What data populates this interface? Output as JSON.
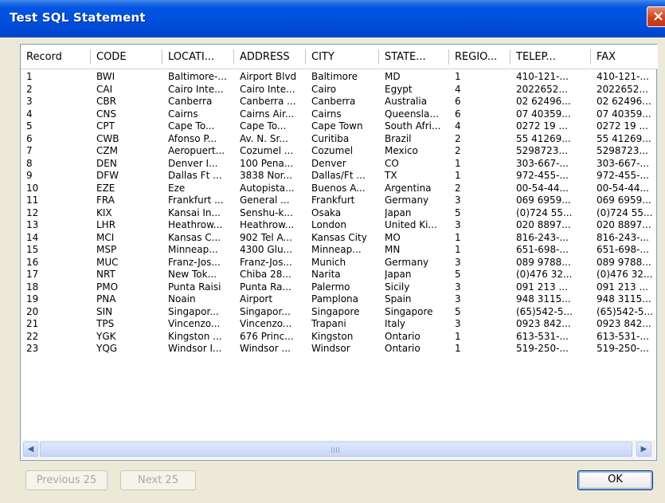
{
  "window": {
    "title": "Test SQL Statement",
    "close_symbol": "×"
  },
  "table": {
    "columns": [
      "Record",
      "CODE",
      "LOCATI...",
      "ADDRESS",
      "CITY",
      "STATE...",
      "REGIO...",
      "TELEP...",
      "FAX"
    ],
    "rows": [
      [
        "1",
        "BWI",
        "Baltimore-...",
        "Airport Blvd",
        "Baltimore",
        "MD",
        "1",
        "410-121-...",
        "410-121-..."
      ],
      [
        "2",
        "CAI",
        "Cairo Inte...",
        "Cairo Inte...",
        "Cairo",
        "Egypt",
        "4",
        "2022652...",
        "2022652..."
      ],
      [
        "3",
        "CBR",
        "Canberra",
        "Canberra ...",
        "Canberra",
        "Australia",
        "6",
        "02 62496...",
        "02 62496..."
      ],
      [
        "4",
        "CNS",
        "Cairns",
        "Cairns Air...",
        "Cairns",
        "Queensla...",
        "6",
        "07 40359...",
        "07 40359..."
      ],
      [
        "5",
        "CPT",
        "Cape To...",
        "Cape To...",
        "Cape Town",
        "South Afri...",
        "4",
        "0272 19 ...",
        "0272 19 ..."
      ],
      [
        "6",
        "CWB",
        "Afonso P...",
        "Av. N. Sr...",
        "Curitiba",
        "Brazil",
        "2",
        "55 41269...",
        "55 41269..."
      ],
      [
        "7",
        "CZM",
        "Aeropuert...",
        "Cozumel ...",
        "Cozumel",
        "Mexico",
        "2",
        "5298723...",
        "5298723..."
      ],
      [
        "8",
        "DEN",
        "Denver I...",
        "100 Pena...",
        "Denver",
        "CO",
        "1",
        "303-667-...",
        "303-667-..."
      ],
      [
        "9",
        "DFW",
        "Dallas Ft ...",
        "3838 Nor...",
        "Dallas/Ft ...",
        "TX",
        "1",
        "972-455-...",
        "972-455-..."
      ],
      [
        "10",
        "EZE",
        "Eze",
        "Autopista...",
        "Buenos A...",
        "Argentina",
        "2",
        "00-54-44...",
        "00-54-44..."
      ],
      [
        "11",
        "FRA",
        "Frankfurt ...",
        "General ...",
        "Frankfurt",
        "Germany",
        "3",
        "069 6959...",
        "069 6959..."
      ],
      [
        "12",
        "KIX",
        "Kansai In...",
        "Senshu-k...",
        "Osaka",
        "Japan",
        "5",
        "(0)724 55...",
        "(0)724 55..."
      ],
      [
        "13",
        "LHR",
        "Heathrow...",
        "Heathrow...",
        "London",
        "United Ki...",
        "3",
        "020 8897...",
        "020 8897..."
      ],
      [
        "14",
        "MCI",
        "Kansas C...",
        "902 Tel A...",
        "Kansas City",
        "MO",
        "1",
        "816-243-...",
        "816-243-..."
      ],
      [
        "15",
        "MSP",
        "Minneap...",
        "4300 Glu...",
        "Minneap...",
        "MN",
        "1",
        "651-698-...",
        "651-698-..."
      ],
      [
        "16",
        "MUC",
        "Franz-Jos...",
        "Franz-Jos...",
        "Munich",
        "Germany",
        "3",
        "089 9788...",
        "089 9788..."
      ],
      [
        "17",
        "NRT",
        "New Tok...",
        "Chiba 28...",
        "Narita",
        "Japan",
        "5",
        "(0)476 32...",
        "(0)476 32..."
      ],
      [
        "18",
        "PMO",
        "Punta Raisi",
        "Punta Ra...",
        "Palermo",
        "Sicily",
        "3",
        "091 213 ...",
        "091 213 ..."
      ],
      [
        "19",
        "PNA",
        "Noain",
        "Airport",
        "Pamplona",
        "Spain",
        "3",
        "948 3115...",
        "948 3115..."
      ],
      [
        "20",
        "SIN",
        "Singapor...",
        "Singapor...",
        "Singapore",
        "Singapore",
        "5",
        "(65)542-5...",
        "(65)542-5..."
      ],
      [
        "21",
        "TPS",
        "Vincenzo...",
        "Vincenzo...",
        "Trapani",
        "Italy",
        "3",
        "0923 842...",
        "0923 842..."
      ],
      [
        "22",
        "YGK",
        "Kingston ...",
        "676 Princ...",
        "Kingston",
        "Ontario",
        "1",
        "613-531-...",
        "613-531-..."
      ],
      [
        "23",
        "YQG",
        "Windsor I...",
        "Windsor ...",
        "Windsor",
        "Ontario",
        "1",
        "519-250-...",
        "519-250-..."
      ]
    ]
  },
  "scrollbar": {
    "left_arrow": "◀",
    "right_arrow": "▶"
  },
  "buttons": {
    "previous": "Previous 25",
    "next": "Next 25",
    "ok": "OK"
  },
  "colors": {
    "title_bar": "#0055e5",
    "window_bg": "#ece9d8",
    "close_button": "#d0431f"
  }
}
